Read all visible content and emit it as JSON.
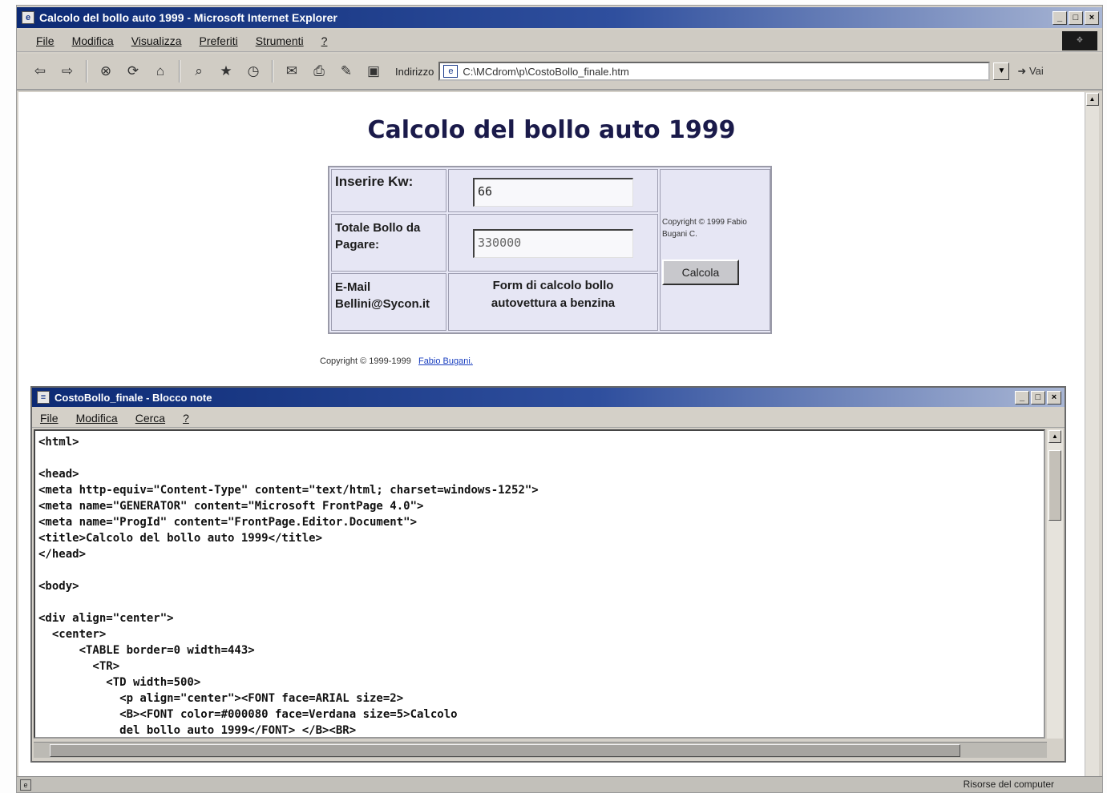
{
  "ie": {
    "title": "Calcolo del bollo auto 1999 - Microsoft Internet Explorer",
    "menu": [
      "File",
      "Modifica",
      "Visualizza",
      "Preferiti",
      "Strumenti",
      "?"
    ],
    "address_label": "Indirizzo",
    "address_value": "C:\\MCdrom\\p\\CostoBollo_finale.htm",
    "go_label": "Vai"
  },
  "page": {
    "title": "Calcolo del bollo auto 1999",
    "kw_label": "Inserire Kw:",
    "kw_value": "66",
    "total_label": "Totale Bollo da Pagare:",
    "total_value": "330000",
    "email_label": "E-Mail Bellini@Sycon.it",
    "note": "Form di calcolo bollo autovettura a benzina",
    "side_copyright": "Copyright © 1999 Fabio Bugani C.",
    "calc_button": "Calcola",
    "footer_copyright": "Copyright © 1999-1999",
    "footer_link": "Fabio Bugani."
  },
  "notepad": {
    "title": "CostoBollo_finale - Blocco note",
    "menu": [
      "File",
      "Modifica",
      "Cerca",
      "?"
    ],
    "lines": [
      "<html>",
      "",
      "<head>",
      "<meta http-equiv=\"Content-Type\" content=\"text/html; charset=windows-1252\">",
      "<meta name=\"GENERATOR\" content=\"Microsoft FrontPage 4.0\">",
      "<meta name=\"ProgId\" content=\"FrontPage.Editor.Document\">",
      "<title>Calcolo del bollo auto 1999</title>",
      "</head>",
      "",
      "<body>",
      "",
      "<div align=\"center\">",
      "  <center>",
      "      <TABLE border=0 width=443>",
      "        <TR>",
      "          <TD width=500>",
      "            <p align=\"center\"><FONT face=ARIAL size=2>",
      "            <B><FONT color=#000080 face=Verdana size=5>Calcolo",
      "            del bollo auto 1999</FONT> </B><BR>"
    ]
  },
  "status": {
    "zone": "Risorse del computer"
  }
}
